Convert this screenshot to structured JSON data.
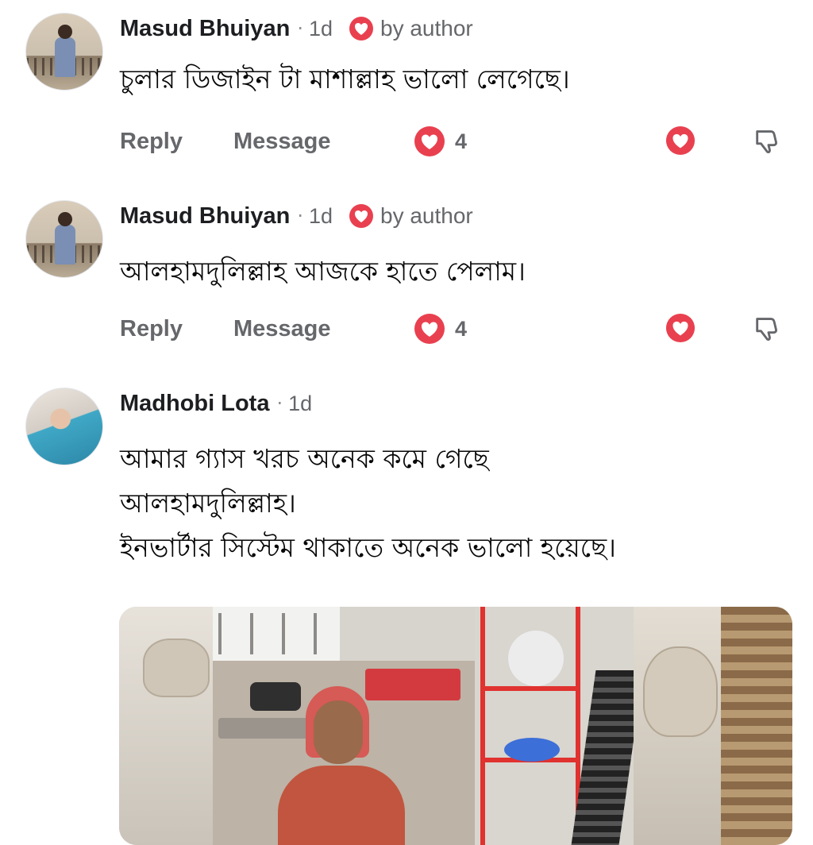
{
  "comments": [
    {
      "author": "Masud Bhuiyan",
      "time": "1d",
      "badge": "by author",
      "text": [
        "চুলার ডিজাইন টা মাশাল্লাহ ভালো লেগেছে।"
      ],
      "actions": {
        "reply": "Reply",
        "message": "Message",
        "reaction_count": "4"
      }
    },
    {
      "author": "Masud Bhuiyan",
      "time": "1d",
      "badge": "by author",
      "text": [
        "আলহামদুলিল্লাহ আজকে হাতে পেলাম।"
      ],
      "actions": {
        "reply": "Reply",
        "message": "Message",
        "reaction_count": "4"
      }
    },
    {
      "author": "Madhobi Lota",
      "time": "1d",
      "text": [
        "আমার গ্যাস খরচ অনেক কমে গেছে",
        "আলহামদুলিল্লাহ।",
        "ইনভার্টার সিস্টেম থাকাতে অনেক ভালো হয়েছে।"
      ]
    }
  ],
  "colors": {
    "love": "#e9404f",
    "secondary_text": "#65676b",
    "primary_text": "#1c1e21"
  },
  "icons": [
    "love-reaction-icon",
    "thumbs-down-icon",
    "author-heart-badge-icon"
  ]
}
